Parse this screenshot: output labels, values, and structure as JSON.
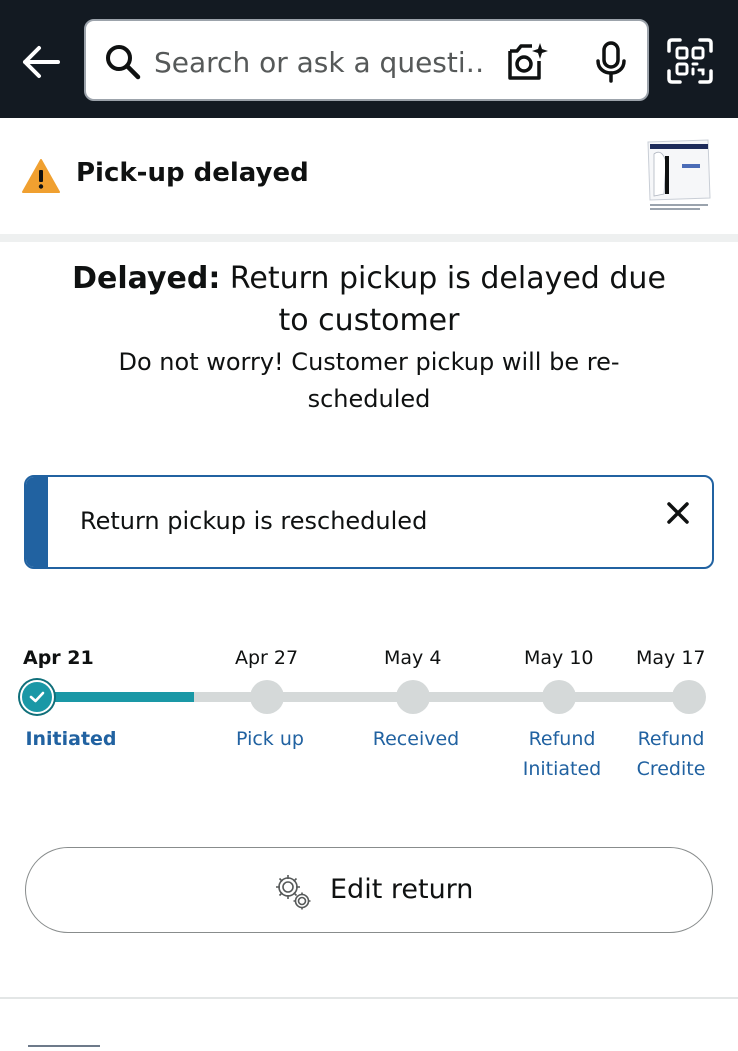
{
  "header": {
    "search_placeholder": "Search or ask a questi…",
    "icons": [
      "back-arrow-icon",
      "search-icon",
      "camera-search-icon",
      "microphone-icon",
      "qr-scan-icon"
    ]
  },
  "status": {
    "title": "Pick-up delayed",
    "icon": "warning-icon",
    "accent_color": "#f0a030"
  },
  "message": {
    "heading_bold": "Delayed:",
    "heading_rest": "Return pickup is delayed due to customer",
    "subtext": "Do not worry! Customer pickup will be re-scheduled"
  },
  "alert": {
    "text": "Return pickup is rescheduled",
    "accent_color": "#2162a1"
  },
  "tracker": {
    "progress_color": "#1a98a6",
    "completed_steps": 1,
    "steps": [
      {
        "date": "Apr 21",
        "label": "Initiated",
        "label_line2": ""
      },
      {
        "date": "Apr 27",
        "label": "Pick up",
        "label_line2": ""
      },
      {
        "date": "May 4",
        "label": "Received",
        "label_line2": ""
      },
      {
        "date": "May 10",
        "label": "Refund",
        "label_line2": "Initiated"
      },
      {
        "date": "May 17",
        "label": "Refund",
        "label_line2": "Credite"
      }
    ]
  },
  "actions": {
    "edit_return_label": "Edit return",
    "edit_icon": "gear-icon"
  }
}
